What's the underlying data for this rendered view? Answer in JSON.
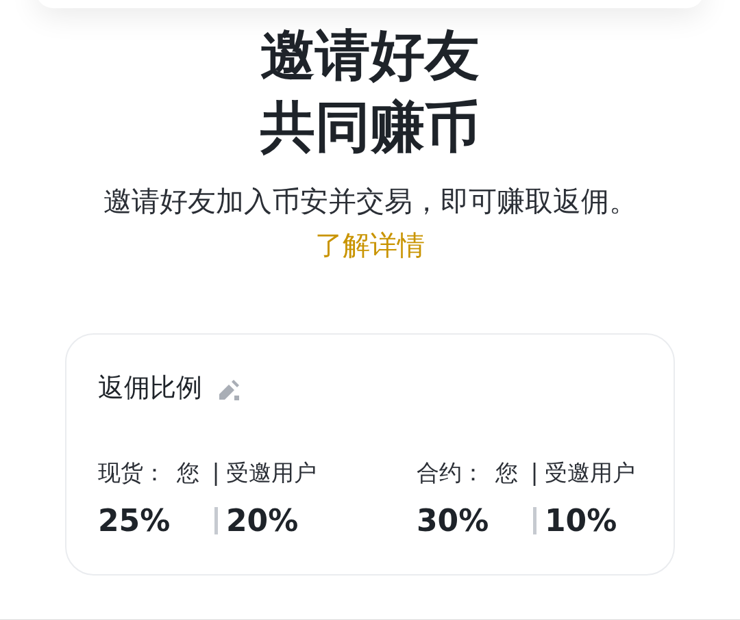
{
  "title_lines": [
    "邀请好友",
    "共同赚币"
  ],
  "description": "邀请好友加入币安并交易，即可赚取返佣。",
  "learn_more_link": "了解详情",
  "commission_card": {
    "title": "返佣比例",
    "groups": [
      {
        "label": "现货：",
        "you_label": "您",
        "separator": "|",
        "invitee_label": "受邀用户",
        "you_value": "25%",
        "invitee_value": "20%"
      },
      {
        "label": "合约：",
        "you_label": "您",
        "separator": "|",
        "invitee_label": "受邀用户",
        "you_value": "30%",
        "invitee_value": "10%"
      }
    ]
  }
}
